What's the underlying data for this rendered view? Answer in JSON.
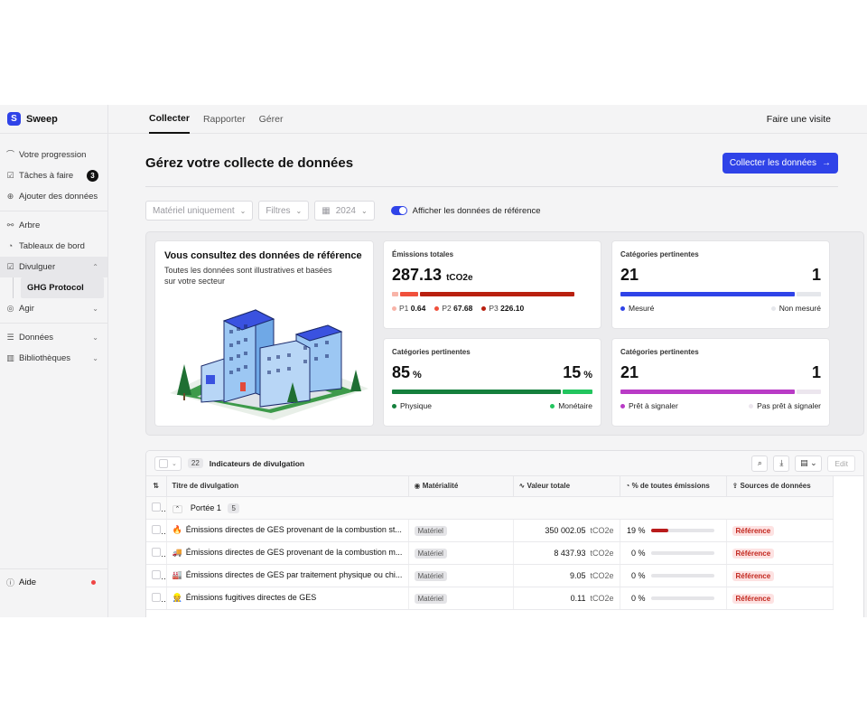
{
  "brand": {
    "name": "Sweep",
    "logo_letter": "S"
  },
  "sidebar": {
    "items": [
      {
        "label": "Votre progression",
        "icon": "route-icon"
      },
      {
        "label": "Tâches à faire",
        "icon": "checkbox-icon",
        "badge": "3"
      },
      {
        "label": "Ajouter des données",
        "icon": "plus-circle-icon"
      },
      {
        "label": "Arbre",
        "icon": "tree-icon"
      },
      {
        "label": "Tableaux de bord",
        "icon": "dashboard-icon"
      },
      {
        "label": "Divulguer",
        "icon": "disclose-icon"
      },
      {
        "label": "GHG Protocol",
        "icon": ""
      },
      {
        "label": "Agir",
        "icon": "target-icon"
      },
      {
        "label": "Données",
        "icon": "database-icon"
      },
      {
        "label": "Bibliothèques",
        "icon": "library-icon"
      }
    ],
    "help": "Aide"
  },
  "topbar": {
    "tabs": [
      "Collecter",
      "Rapporter",
      "Gérer"
    ],
    "visit": "Faire une visite"
  },
  "header": {
    "title": "Gérez votre collecte de données",
    "cta": "Collecter les données"
  },
  "filters": {
    "materiality": "Matériel uniquement",
    "filters": "Filtres",
    "year": "2024",
    "toggle_label": "Afficher les données de référence"
  },
  "reference_card": {
    "title": "Vous consultez des données de référence",
    "subtitle": "Toutes les données sont illustratives et basées sur votre secteur"
  },
  "emissions_card": {
    "label": "Émissions totales",
    "value": "287.13",
    "unit": "tCO2e",
    "p1_label": "P1",
    "p1_value": "0.64",
    "p2_label": "P2",
    "p2_value": "67.68",
    "p3_label": "P3",
    "p3_value": "226.10",
    "colors": {
      "p1": "#f8b4a8",
      "p2": "#f0503c",
      "p3": "#b9200f"
    }
  },
  "measured_card": {
    "label": "Catégories pertinentes",
    "left": "21",
    "right": "1",
    "left_legend": "Mesuré",
    "right_legend": "Non mesuré",
    "fraction": 0.875,
    "color": "#2f43e8"
  },
  "physical_card": {
    "label": "Catégories pertinentes",
    "left": "85",
    "right": "15",
    "unit": "%",
    "left_legend": "Physique",
    "right_legend": "Monétaire",
    "fraction": 0.85,
    "colors": {
      "left": "#15803d",
      "right": "#22c55e"
    }
  },
  "ready_card": {
    "label": "Catégories pertinentes",
    "left": "21",
    "right": "1",
    "left_legend": "Prêt à signaler",
    "right_legend": "Pas prêt à signaler",
    "fraction": 0.875,
    "color": "#b93bc6"
  },
  "table": {
    "count": "22",
    "title": "Indicateurs de divulgation",
    "edit": "Edit",
    "columns": [
      "Titre de divulgation",
      "Matérialité",
      "Valeur totale",
      "% de toutes émissions",
      "Sources de données"
    ],
    "group": {
      "label": "Portée 1",
      "count": "5"
    },
    "rows": [
      {
        "emoji": "🔥",
        "title": "Émissions directes de GES provenant de la combustion st...",
        "materiality": "Matériel",
        "value": "350 002.05",
        "unit": "tCO2e",
        "pct": "19 %",
        "pct_num": 0.19,
        "source": "Référence"
      },
      {
        "emoji": "🚚",
        "title": "Émissions directes de GES provenant de la combustion m...",
        "materiality": "Matériel",
        "value": "8 437.93",
        "unit": "tCO2e",
        "pct": "0 %",
        "pct_num": 0,
        "source": "Référence"
      },
      {
        "emoji": "🏭",
        "title": "Émissions directes de GES par traitement physique ou chi...",
        "materiality": "Matériel",
        "value": "9.05",
        "unit": "tCO2e",
        "pct": "0 %",
        "pct_num": 0,
        "source": "Référence"
      },
      {
        "emoji": "👷",
        "title": "Émissions fugitives directes de GES",
        "materiality": "Matériel",
        "value": "0.11",
        "unit": "tCO2e",
        "pct": "0 %",
        "pct_num": 0,
        "source": "Référence"
      }
    ]
  }
}
